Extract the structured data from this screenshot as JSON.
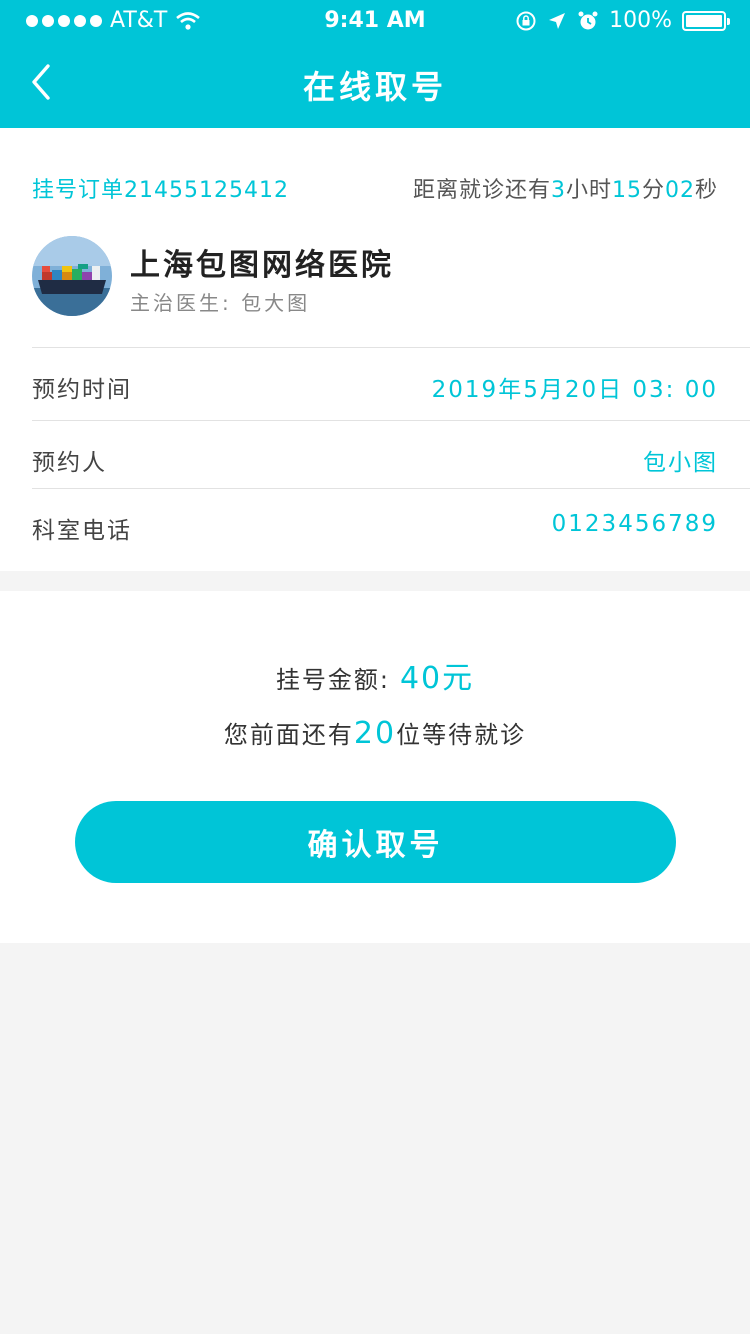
{
  "status_bar": {
    "carrier": "AT&T",
    "time": "9:41 AM",
    "battery": "100%"
  },
  "nav": {
    "title": "在线取号"
  },
  "order": {
    "label": "挂号订单",
    "number": "21455125412",
    "countdown_prefix": "距离就诊还有",
    "hours": "3",
    "hours_unit": "小时",
    "minutes": "15",
    "minutes_unit": "分",
    "seconds": "02",
    "seconds_unit": "秒"
  },
  "hospital": {
    "name": "上海包图网络医院",
    "doctor_label": "主治医生:",
    "doctor_name": "包大图"
  },
  "details": [
    {
      "label": "预约时间",
      "value": "2019年5月20日 03: 00"
    },
    {
      "label": "预约人",
      "value": "包小图"
    },
    {
      "label": "科室电话",
      "value": "0123456789"
    }
  ],
  "payment": {
    "fee_label": "挂号金额:",
    "fee_amount": "40元",
    "queue_prefix": "您前面还有",
    "queue_count": "20",
    "queue_suffix": "位等待就诊"
  },
  "confirm_button": "确认取号",
  "colors": {
    "accent": "#00c5d7",
    "background": "#f4f4f4",
    "card": "#ffffff"
  },
  "icons": [
    "signal-dots-icon",
    "wifi-icon",
    "rotation-lock-icon",
    "location-arrow-icon",
    "alarm-icon",
    "battery-icon",
    "back-chevron-icon",
    "hospital-avatar-ship-image"
  ]
}
